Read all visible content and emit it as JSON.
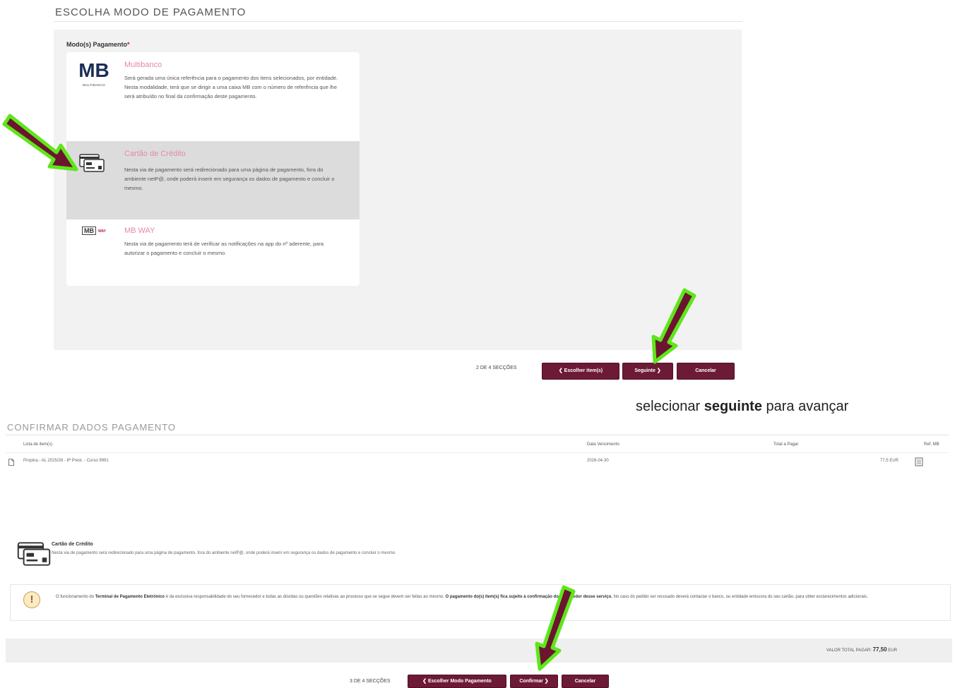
{
  "section1": {
    "title": "ESCOLHA MODO DE PAGAMENTO",
    "modes_label": "Modo(s) Pagamento",
    "required_mark": "*",
    "options": [
      {
        "icon": "multibanco-logo-icon",
        "logo_text": "MB",
        "logo_subtext": "MULTIBANCO",
        "title": "Multibanco",
        "description": "Será gerada uma única referência para o pagamento dos itens selecionados, por entidade. Nesta modalidade, terá que se dirigir a uma caixa MB com o número de referência que lhe será atribuído no final da confirmação deste pagamento.",
        "selected": false
      },
      {
        "icon": "credit-card-icon",
        "title": "Cartão de Crédito",
        "description": "Nesta via de pagamento será redirecionado para uma página de pagamento, fora do ambiente netP@, onde poderá inserir em segurança os dados de pagamento e concluir o mesmo.",
        "selected": true
      },
      {
        "icon": "mbway-logo-icon",
        "logo_text": "MB",
        "logo_subtext": "WAY",
        "title": "MB WAY",
        "description": "Nesta via de pagamento terá de verificar as notificações na app do nº aderente, para autorizar o pagamento e concluir o mesmo.",
        "selected": false
      }
    ],
    "pager": "2 DE 4 SECÇÕES",
    "buttons": {
      "back": "❮ Escolher item(s)",
      "next": "Seguinte ❯",
      "cancel": "Cancelar"
    }
  },
  "caption": {
    "prefix": "selecionar ",
    "bold": "seguinte",
    "suffix": " para avançar"
  },
  "section2": {
    "title": "CONFIRMAR DADOS PAGAMENTO",
    "table": {
      "headers": [
        "Lista de item(s)",
        "Data Vencimento",
        "Total a Pagar",
        "Ref. MB"
      ],
      "rows": [
        {
          "item": "Propina - AL 2025/26 - 8ª Prest. - Curso 9991",
          "due_date": "2026-04-30",
          "total": "77,5 EUR",
          "ref_icon": "document-icon"
        }
      ]
    },
    "method": {
      "title": "Cartão de Crédito",
      "description": "Nesta via de pagamento será redirecionado para uma página de pagamento, fora do ambiente netP@, onde poderá inserir em segurança os dados de pagamento e concluir o mesmo."
    },
    "warning": {
      "part1": "O funcionamento do ",
      "bold1": "Terminal de Pagamento Eletrónico",
      "part2": " é da exclusiva responsabilidade do seu fornecedor e todas as dúvidas ou questões relativas ao processo que se segue devem ser feitas ao mesmo. ",
      "bold2": "O pagamento do(s) item(s) fica sujeito à confirmação do fornecedor desse serviço.",
      "part3": " No caso do pedido ser recusado deverá contactar o banco, ou entidade emissora do seu cartão, para obter esclarecimentos adicionais."
    },
    "total_label": "VALOR TOTAL PAGAR: ",
    "total_value": "77,50",
    "total_currency": " EUR",
    "pager": "3 DE 4 SECÇÕES",
    "buttons": {
      "back": "❮ Escolher Modo Pagamento",
      "confirm": "Confirmar ❯",
      "cancel": "Cancelar"
    }
  },
  "colors": {
    "button": "#6d1a36",
    "arrow_fill": "#6b1530",
    "arrow_outline": "#5ee61a",
    "option_title": "#e48aa6"
  }
}
